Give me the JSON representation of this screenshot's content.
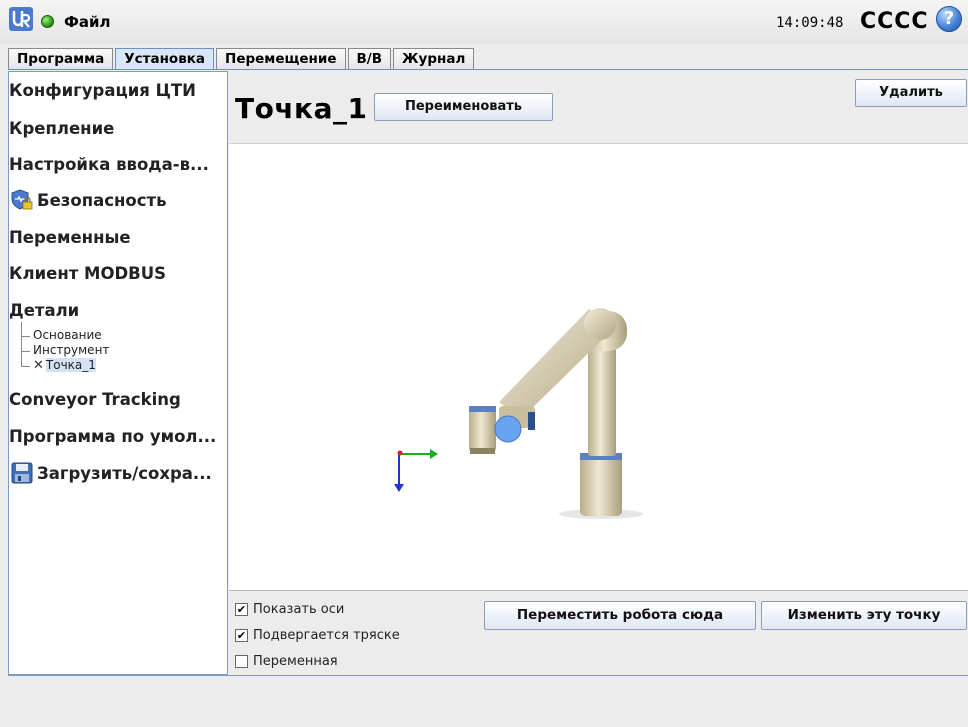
{
  "header": {
    "file_menu": "Файл",
    "clock": "14:09:48",
    "robot_name": "CCCC",
    "help_icon_glyph": "?",
    "logo_icon": "ur-logo-icon",
    "status_icon": "status-ok-icon",
    "status_color": "#2e9d1e"
  },
  "tabs": [
    {
      "label": "Программа",
      "active": false
    },
    {
      "label": "Установка",
      "active": true
    },
    {
      "label": "Перемещение",
      "active": false
    },
    {
      "label": "В/В",
      "active": false
    },
    {
      "label": "Журнал",
      "active": false
    }
  ],
  "sidebar": {
    "items": [
      {
        "label": "Конфигурация ЦТИ"
      },
      {
        "label": "Крепление"
      },
      {
        "label": "Настройка ввода-в..."
      },
      {
        "label": "Безопасность",
        "icon": "shield-lock-icon"
      },
      {
        "label": "Переменные"
      },
      {
        "label": "Клиент MODBUS"
      },
      {
        "label": "Детали"
      },
      {
        "label": "Conveyor Tracking"
      },
      {
        "label": "Программа по умол..."
      },
      {
        "label": "Загрузить/сохра...",
        "icon": "floppy-disk-icon"
      }
    ],
    "features": [
      {
        "label": "Основание"
      },
      {
        "label": "Инструмент"
      },
      {
        "label": "Точка_1",
        "icon": "point-x-icon",
        "selected": true
      }
    ]
  },
  "main": {
    "title": "Точка_1",
    "rename_label": "Переименовать",
    "delete_label": "Удалить",
    "checkboxes": [
      {
        "label": "Показать оси",
        "checked": true,
        "mark": "✔"
      },
      {
        "label": "Подвергается тряске",
        "checked": true,
        "mark": "✔"
      },
      {
        "label": "Переменная",
        "checked": false,
        "mark": ""
      }
    ],
    "move_here_label": "Переместить робота сюда",
    "change_point_label": "Изменить эту точку"
  },
  "colors": {
    "accent": "#6f91c1",
    "active_tab": "#d8e6f6",
    "selection": "#d4e2f5",
    "robot_body": "#e2d9bf",
    "robot_joint": "#4a7ad0"
  }
}
